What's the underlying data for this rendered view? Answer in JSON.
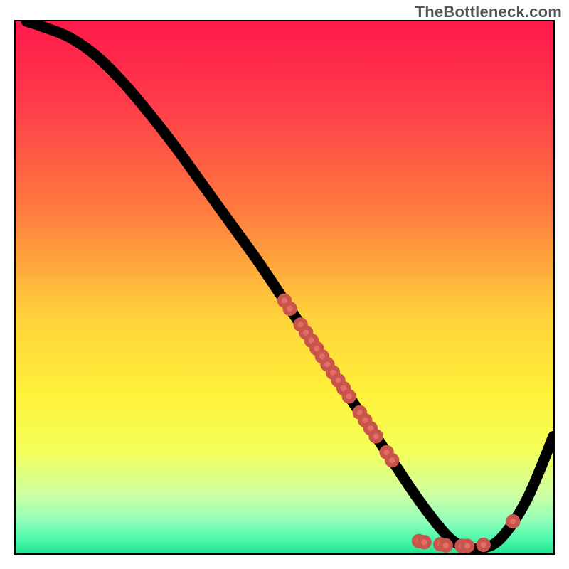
{
  "watermark": "TheBottleneck.com",
  "chart_data": {
    "type": "line",
    "title": "",
    "xlabel": "",
    "ylabel": "",
    "xlim": [
      0,
      100
    ],
    "ylim": [
      0,
      100
    ],
    "grid": false,
    "legend": false,
    "series": [
      {
        "name": "curve",
        "kind": "line",
        "x": [
          2,
          5,
          10,
          15,
          20,
          25,
          30,
          35,
          40,
          45,
          50,
          55,
          60,
          65,
          70,
          75,
          80,
          83,
          86,
          90,
          95,
          100
        ],
        "y": [
          100,
          99,
          97,
          93.5,
          88.5,
          82.5,
          76,
          69,
          62,
          55,
          47.5,
          40,
          32.5,
          25,
          17.5,
          10,
          3.6,
          1.4,
          0.9,
          2.6,
          10,
          22
        ]
      },
      {
        "name": "dots-on-curve",
        "kind": "scatter",
        "points": [
          {
            "x": 50,
            "y": 47.5
          },
          {
            "x": 51,
            "y": 46
          },
          {
            "x": 53,
            "y": 43
          },
          {
            "x": 54,
            "y": 41.5
          },
          {
            "x": 55,
            "y": 40
          },
          {
            "x": 56,
            "y": 38.5
          },
          {
            "x": 57,
            "y": 37
          },
          {
            "x": 58,
            "y": 35.5
          },
          {
            "x": 59,
            "y": 34
          },
          {
            "x": 60,
            "y": 32.5
          },
          {
            "x": 61,
            "y": 31
          },
          {
            "x": 62,
            "y": 29.5
          },
          {
            "x": 64,
            "y": 26.5
          },
          {
            "x": 65,
            "y": 25
          },
          {
            "x": 66,
            "y": 23.5
          },
          {
            "x": 67,
            "y": 22
          },
          {
            "x": 69,
            "y": 19
          },
          {
            "x": 70,
            "y": 17.5
          },
          {
            "x": 75,
            "y": 2.3
          },
          {
            "x": 76,
            "y": 2.1
          },
          {
            "x": 79,
            "y": 1.7
          },
          {
            "x": 80,
            "y": 1.5
          },
          {
            "x": 83,
            "y": 1.4
          },
          {
            "x": 84,
            "y": 1.4
          },
          {
            "x": 87,
            "y": 1.6
          },
          {
            "x": 92.5,
            "y": 6
          }
        ]
      }
    ],
    "gradient_stops": [
      {
        "offset": 0.0,
        "color": "#ff1a4b"
      },
      {
        "offset": 0.15,
        "color": "#ff3a4a"
      },
      {
        "offset": 0.35,
        "color": "#ff7a3f"
      },
      {
        "offset": 0.55,
        "color": "#ffd23a"
      },
      {
        "offset": 0.7,
        "color": "#fff23a"
      },
      {
        "offset": 0.8,
        "color": "#f3ff5a"
      },
      {
        "offset": 0.88,
        "color": "#ceffa3"
      },
      {
        "offset": 0.93,
        "color": "#8fffba"
      },
      {
        "offset": 0.965,
        "color": "#49f7a9"
      },
      {
        "offset": 1.0,
        "color": "#12dd85"
      }
    ]
  }
}
